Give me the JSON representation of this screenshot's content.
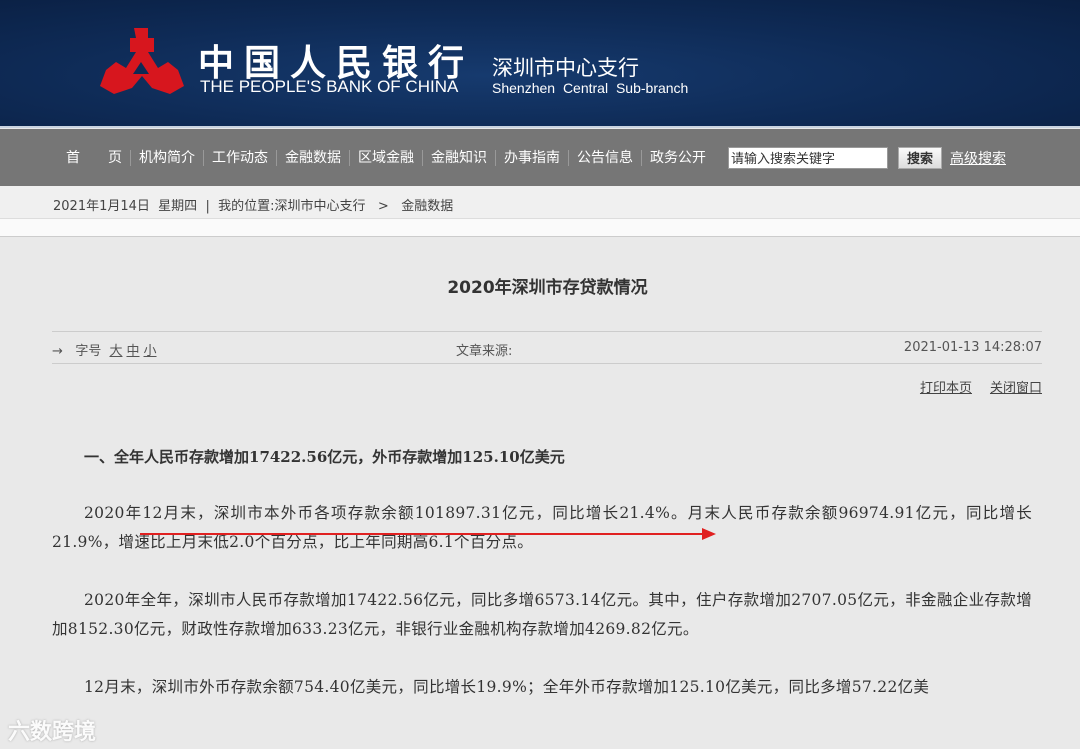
{
  "header": {
    "logo_cn": "中国人民银行",
    "logo_en": "THE PEOPLE'S BANK OF CHINA",
    "branch_cn": "深圳市中心支行",
    "branch_en": "Shenzhen Central Sub-branch"
  },
  "nav": {
    "items": [
      "首　　页",
      "机构简介",
      "工作动态",
      "金融数据",
      "区域金融",
      "金融知识",
      "办事指南",
      "公告信息",
      "政务公开"
    ],
    "search_placeholder": "请输入搜索关键字",
    "search_label": "搜索",
    "advanced_label": "高级搜索"
  },
  "breadcrumb": {
    "date": "2021年1月14日",
    "weekday": "星期四",
    "location_label": "我的位置:",
    "path": [
      "深圳市中心支行",
      "金融数据"
    ],
    "separator": ">"
  },
  "article": {
    "title": "2020年深圳市存贷款情况",
    "font_label": "字号",
    "sizes": [
      "大",
      "中",
      "小"
    ],
    "source_label": "文章来源:",
    "datetime": "2021-01-13 14:28:07",
    "print_label": "打印本页",
    "close_label": "关闭窗口",
    "heading": "一、全年人民币存款增加17422.56亿元，外币存款增加125.10亿美元",
    "paragraphs": [
      "2020年12月末，深圳市本外币各项存款余额101897.31亿元，同比增长21.4%。月末人民币存款余额96974.91亿元，同比增长21.9%，增速比上月末低2.0个百分点，比上年同期高6.1个百分点。",
      "2020年全年，深圳市人民币存款增加17422.56亿元，同比多增6573.14亿元。其中，住户存款增加2707.05亿元，非金融企业存款增加8152.30亿元，财政性存款增加633.23亿元，非银行业金融机构存款增加4269.82亿元。",
      "12月末，深圳市外币存款余额754.40亿美元，同比增长19.9%；全年外币存款增加125.10亿美元，同比多增57.22亿美"
    ]
  },
  "watermark": "六数跨境",
  "colors": {
    "header_bg": "#0e2a55",
    "nav_bg": "#767676",
    "logo_red": "#d7161e",
    "annotation_red": "#e02020"
  }
}
